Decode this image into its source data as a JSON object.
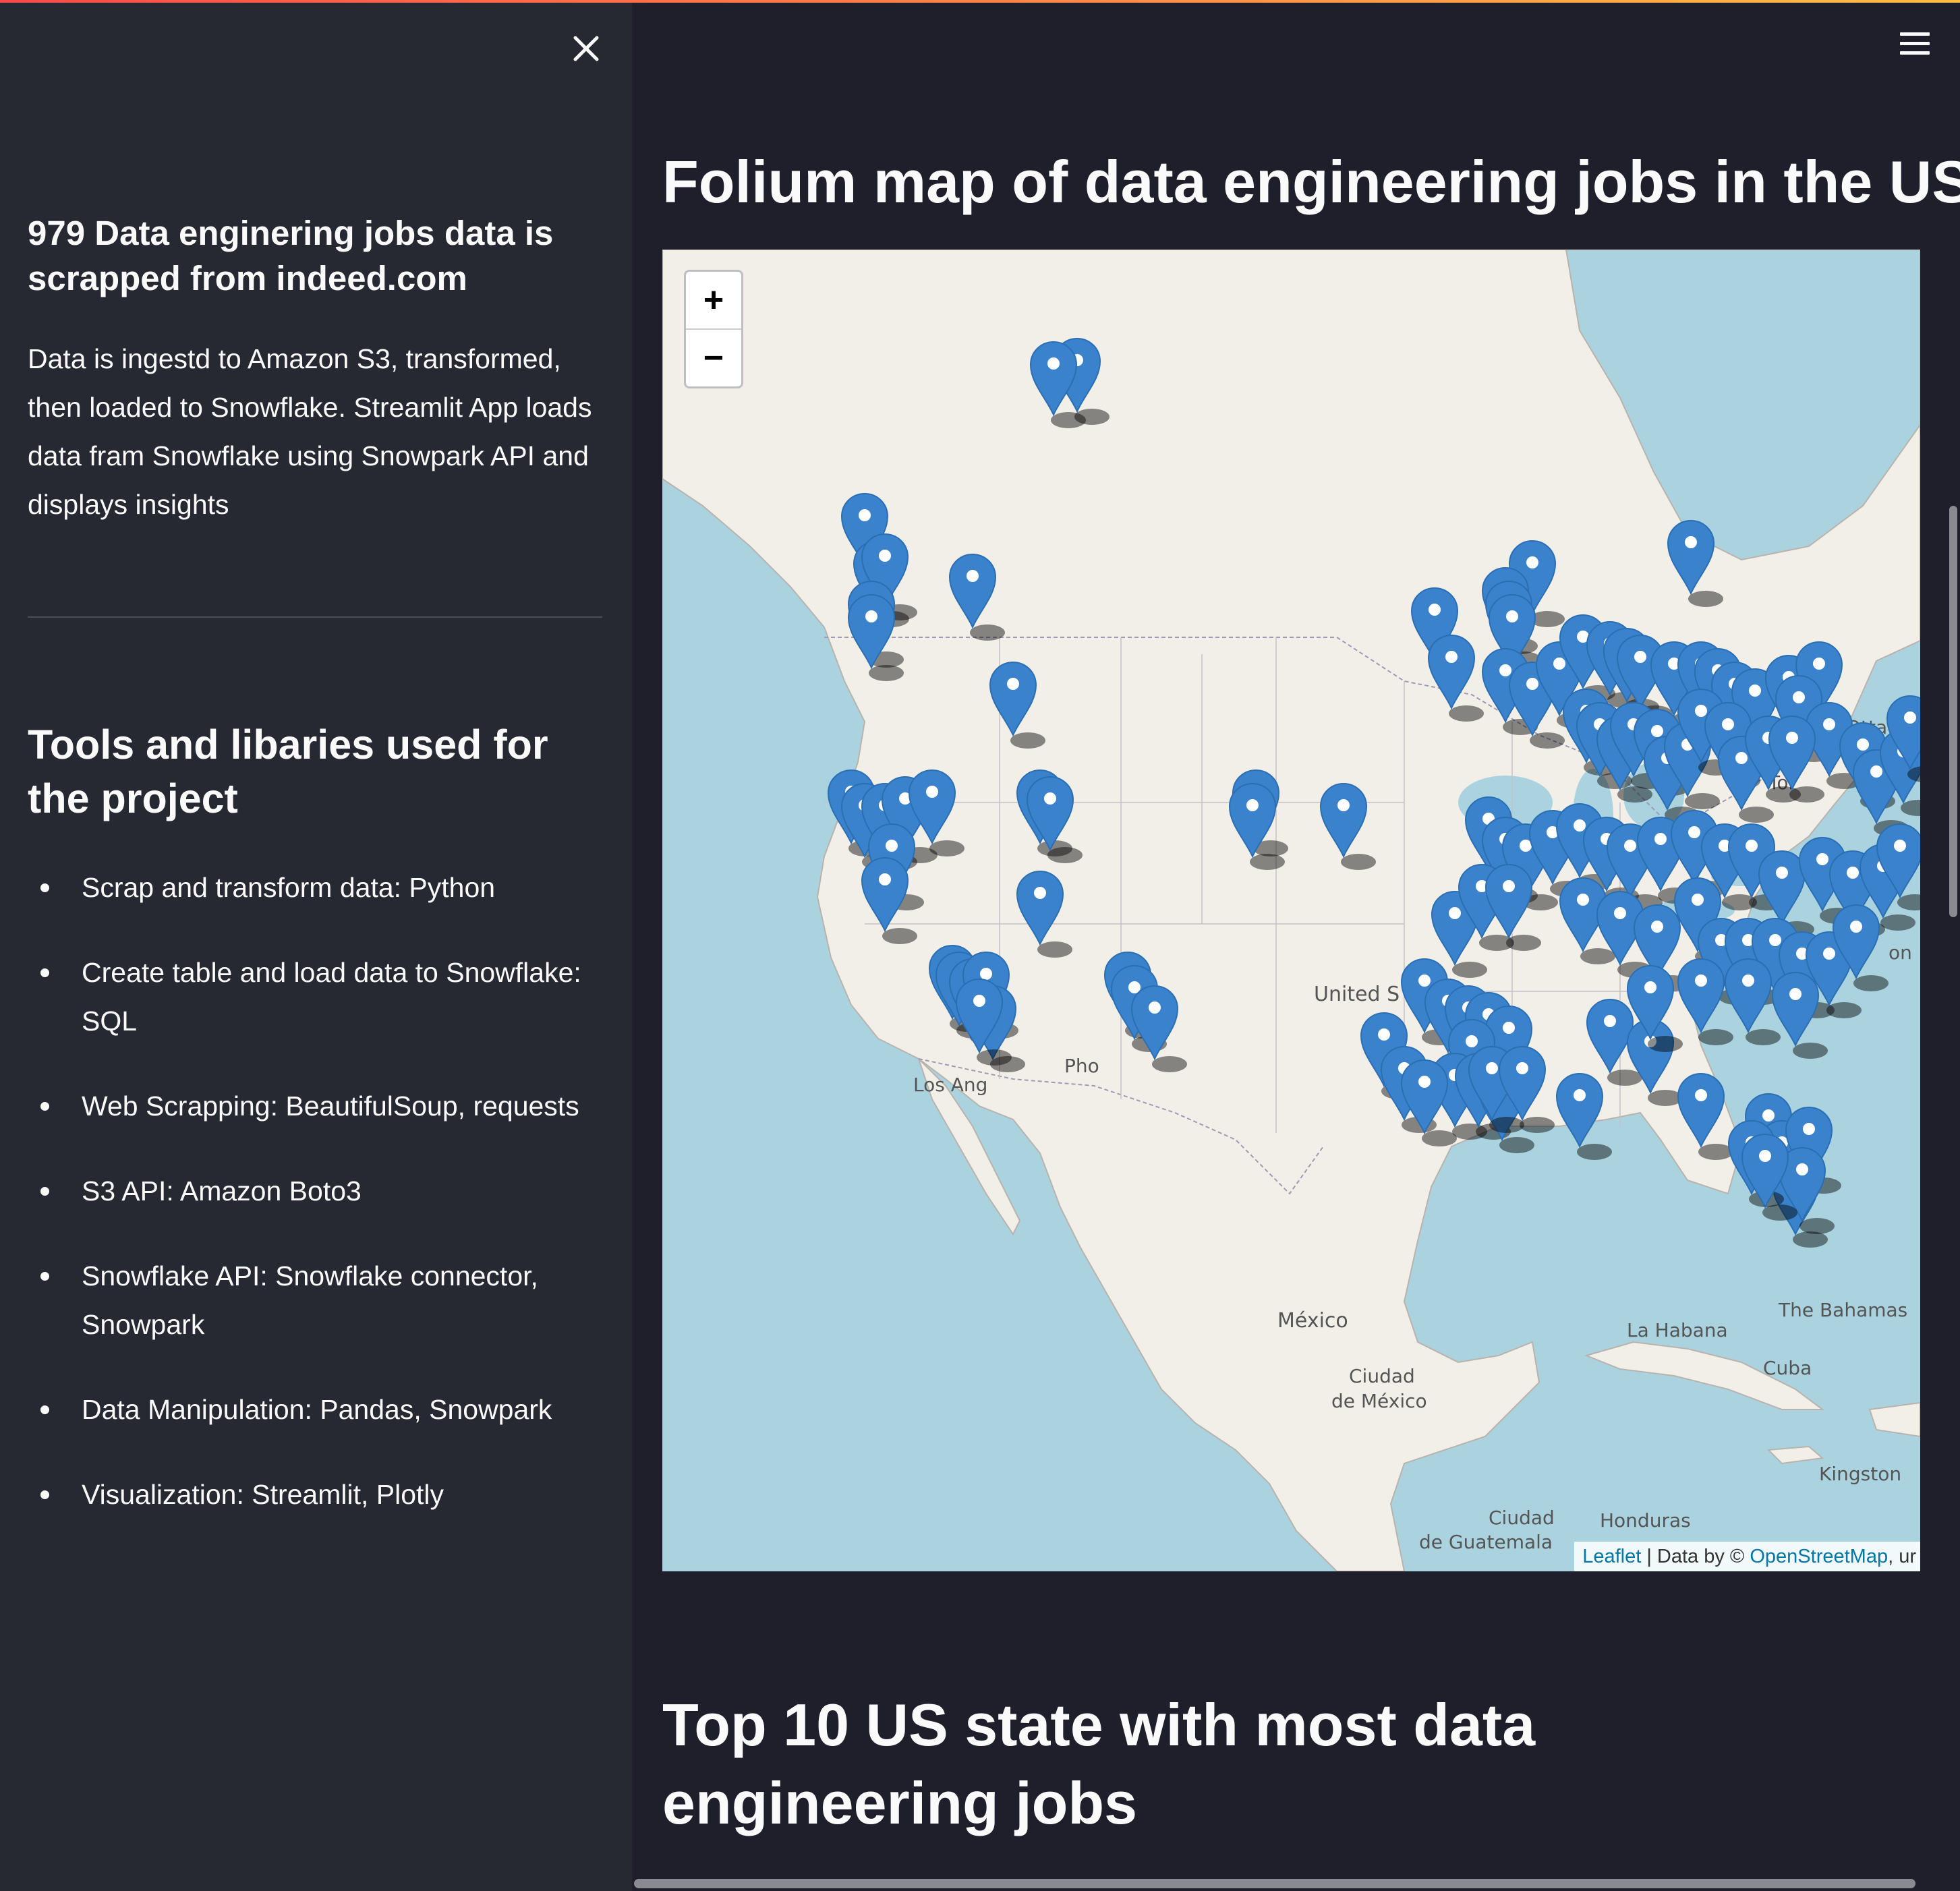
{
  "sidebar": {
    "heading": "979 Data enginering jobs data is scrapped from indeed.com",
    "description": "Data is ingestd to Amazon S3, transformed, then loaded to Snowflake. Streamlit App loads data fram Snowflake using Snowpark API and displays insights",
    "tools_heading": "Tools and libaries used for the project",
    "tools": [
      "Scrap and transform data: Python",
      "Create table and load data to Snowflake: SQL",
      "Web Scrapping: BeautifulSoup, requests",
      "S3 API: Amazon Boto3",
      "Snowflake API: Snowflake connector, Snowpark",
      "Data Manipulation: Pandas, Snowpark",
      "Visualization: Streamlit, Plotly"
    ]
  },
  "main": {
    "map_title": "Folium map of data engineering jobs in the US",
    "map": {
      "zoom_in": "+",
      "zoom_out": "−",
      "attribution_leaflet": "Leaflet",
      "attribution_sep": " | Data by © ",
      "attribution_osm": "OpenStreetMap",
      "attribution_tail": ", ur",
      "labels": {
        "ottawa": "Ottawa",
        "toronto": "Tor",
        "united_states": "United S",
        "los_angeles": "Los Ang",
        "phoenix": "Pho",
        "mexico": "México",
        "mexico_city_1": "Ciudad",
        "mexico_city_2": "de México",
        "la_habana": "La Habana",
        "cuba": "Cuba",
        "bahamas": "The Bahamas",
        "kingston": "Kingston",
        "guatemala_1": "Ciudad",
        "guatemala_2": "de Guatemala",
        "honduras": "Honduras",
        "new_york_fragment": "on"
      }
    },
    "top10_title": "Top 10 US state with most data engineering jobs"
  },
  "colors": {
    "sidebar_bg": "#262832",
    "main_bg": "#1e1f2b",
    "text": "#fafafa",
    "water": "#aad3df",
    "land": "#f2efe9",
    "marker": "#3a82cc"
  }
}
